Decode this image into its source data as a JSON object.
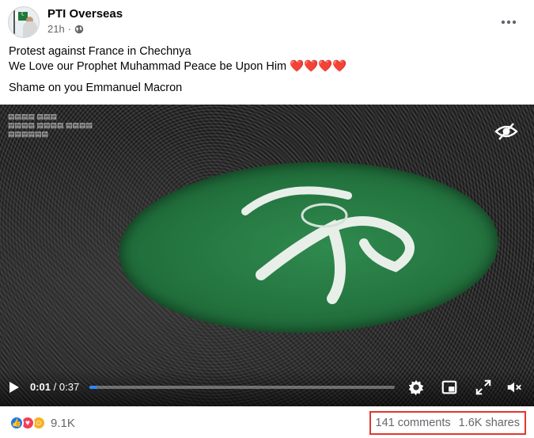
{
  "post": {
    "page_name": "PTI Overseas",
    "time": "21h",
    "separator": "·",
    "audience_icon": "globe-icon",
    "more_icon": "more-options-icon",
    "line1": "Protest against France in Chechnya",
    "line2": "We Love our Prophet Muhammad Peace be Upon Him",
    "line2_emoji": "❤️❤️❤️❤️",
    "line3": "Shame on you Emmanuel Macron"
  },
  "video": {
    "current_time": "0:01",
    "duration": "/ 0:37",
    "progress": 0.027,
    "accent": "#2d88ff",
    "icons": [
      "play-icon",
      "settings-icon",
      "picture-in-picture-icon",
      "fullscreen-icon",
      "muted-volume-icon",
      "eye-icon"
    ]
  },
  "engagement": {
    "reactions_count": "9.1K",
    "comments": "141 comments",
    "shares": "1.6K shares",
    "highlight_color": "#e0382f"
  }
}
